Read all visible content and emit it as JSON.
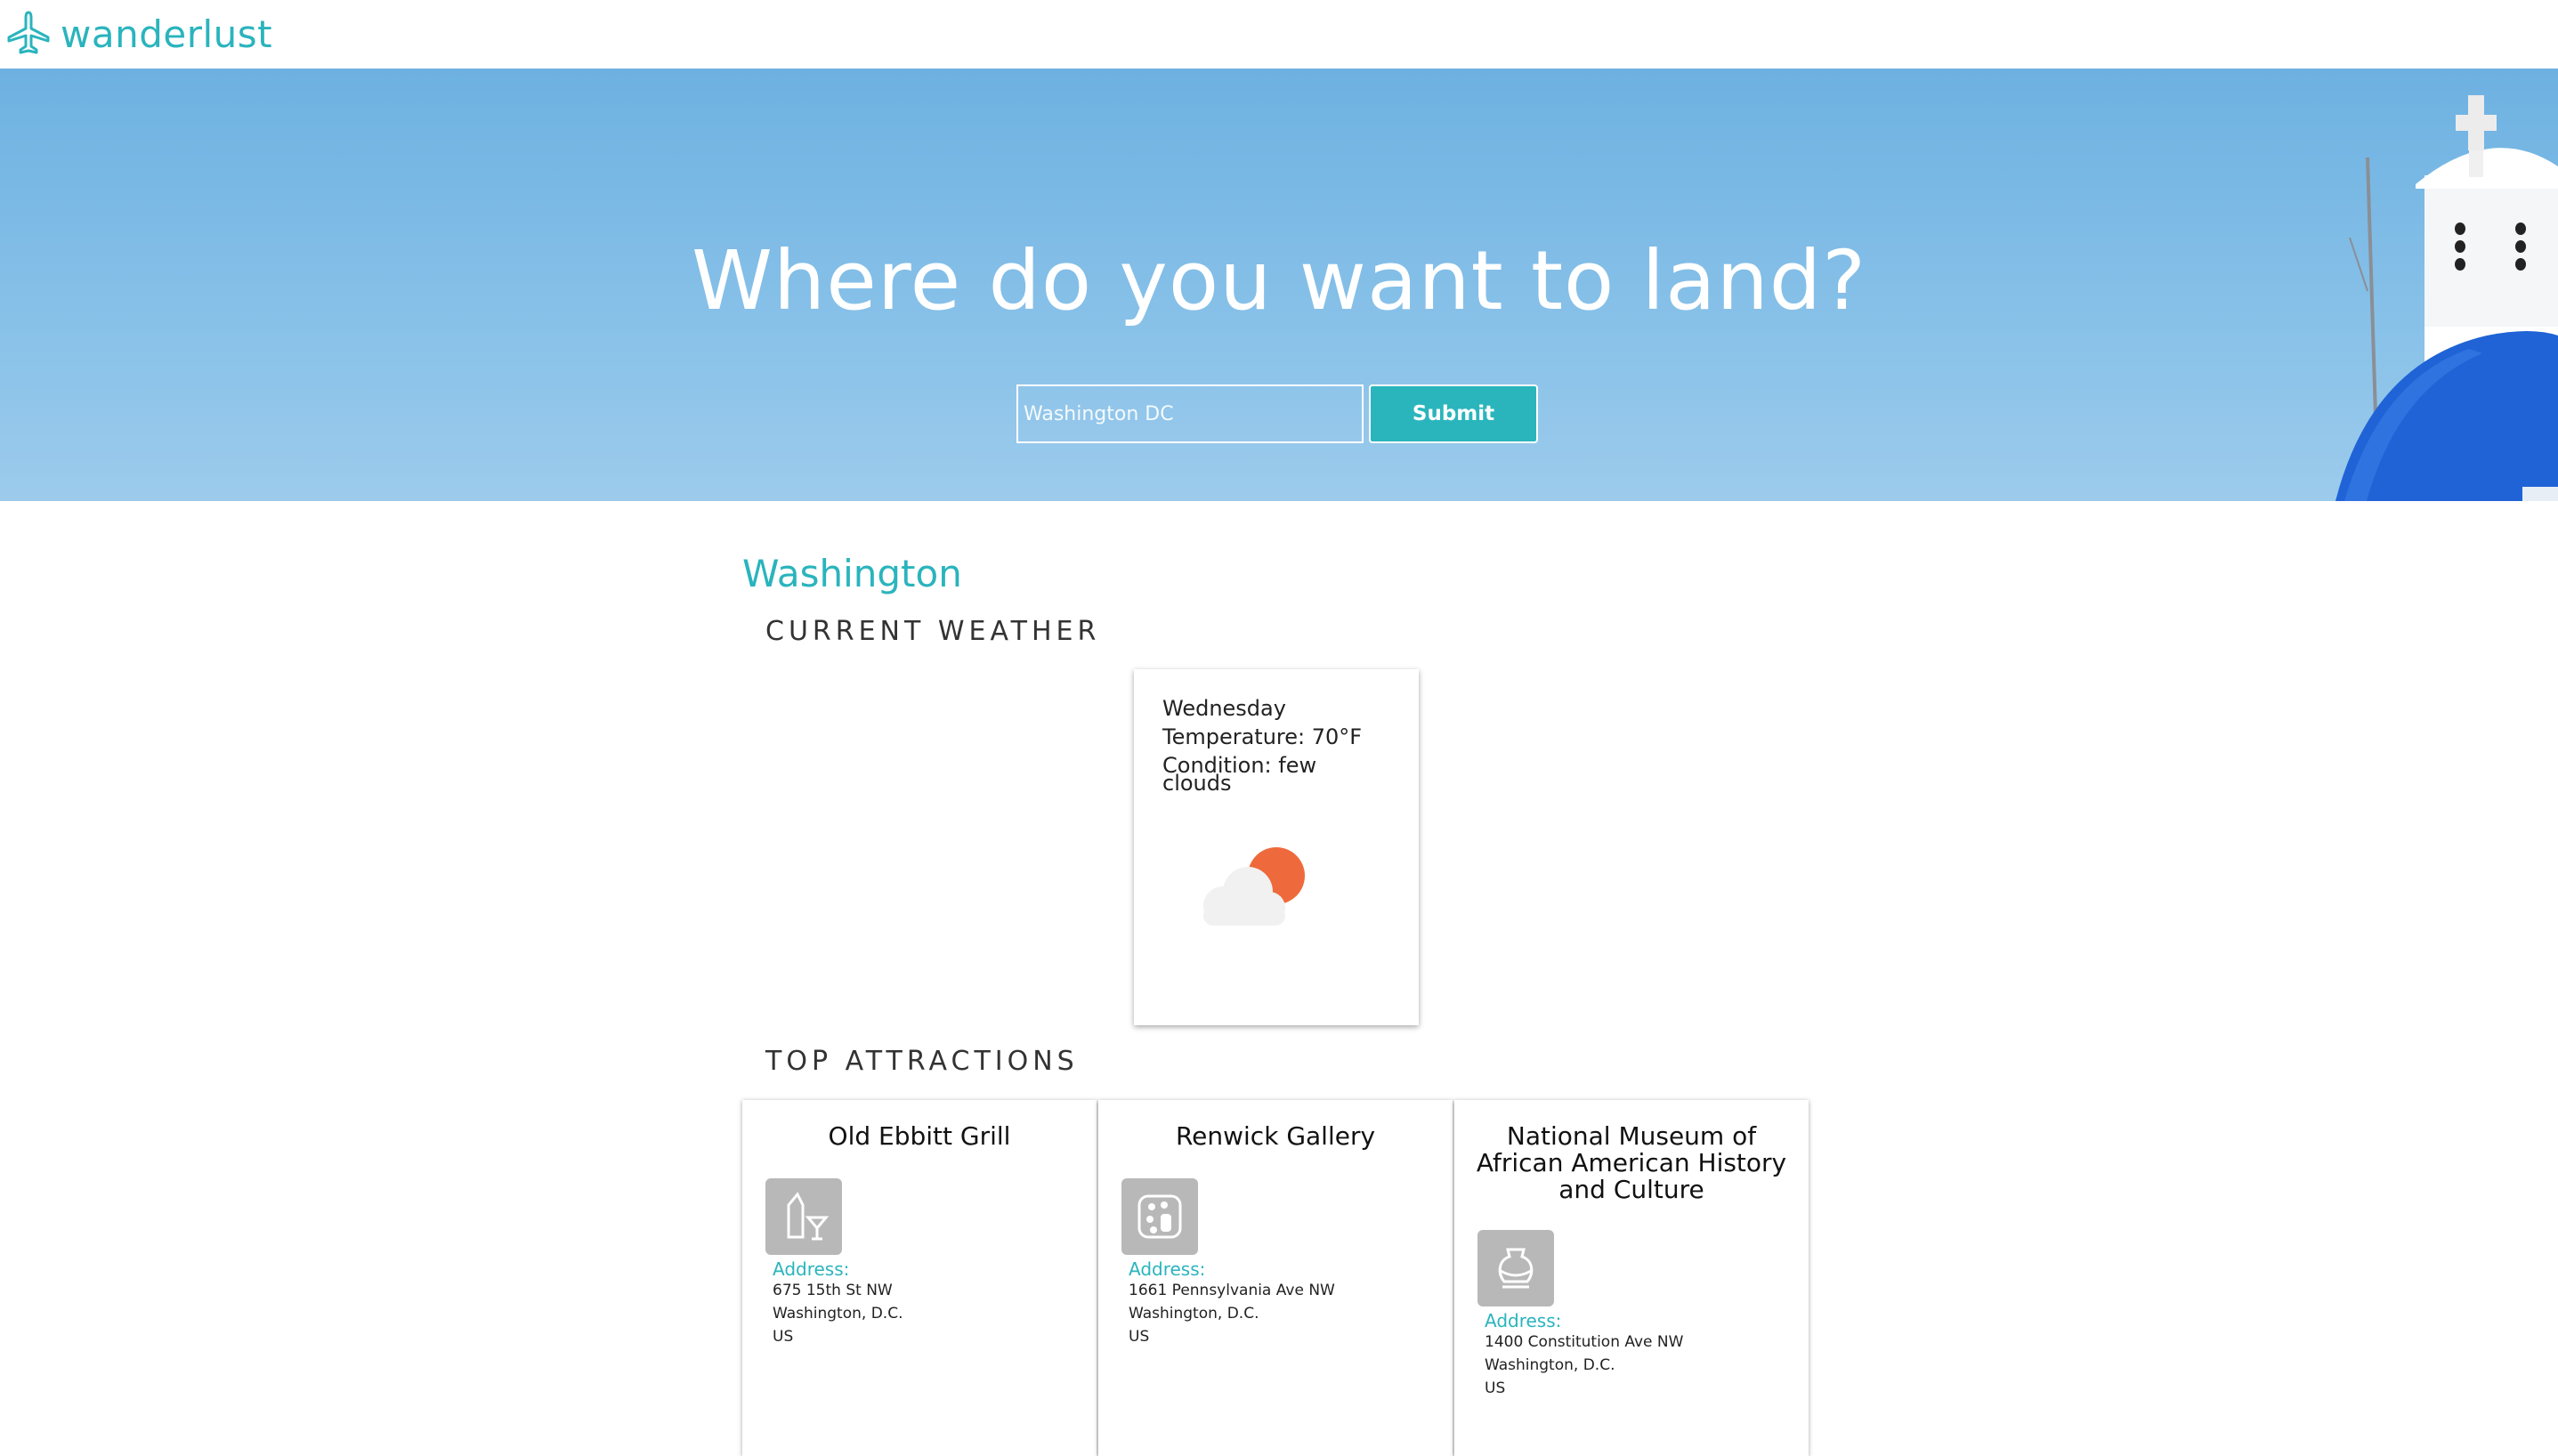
{
  "brand": {
    "name": "wanderlust",
    "icon": "airplane-icon"
  },
  "hero": {
    "title": "Where do you want to land?",
    "search_placeholder": "Washington DC",
    "submit_label": "Submit"
  },
  "city": {
    "name": "Washington"
  },
  "weather": {
    "heading": "CURRENT WEATHER",
    "day": "Wednesday",
    "temperature": "Temperature: 70°F",
    "condition": "Condition: few clouds",
    "icon": "partly-cloudy-icon"
  },
  "attractions": {
    "heading": "TOP ATTRACTIONS",
    "address_label": "Address:",
    "items": [
      {
        "name": "Old Ebbitt Grill",
        "icon": "bar-drinks-icon",
        "address": [
          "675 15th St NW",
          "Washington, D.C.",
          "US"
        ]
      },
      {
        "name": "Renwick Gallery",
        "icon": "art-gallery-icon",
        "address": [
          "1661 Pennsylvania Ave NW",
          "Washington, D.C.",
          "US"
        ]
      },
      {
        "name": "National Museum of African American History and Culture",
        "icon": "museum-vase-icon",
        "address": [
          "1400 Constitution Ave NW",
          "Washington, D.C.",
          "US"
        ]
      }
    ]
  },
  "colors": {
    "accent": "#2ab4bd",
    "sky": "#7ab9e6",
    "dome": "#1f63d6",
    "sun": "#ee6a3c"
  }
}
